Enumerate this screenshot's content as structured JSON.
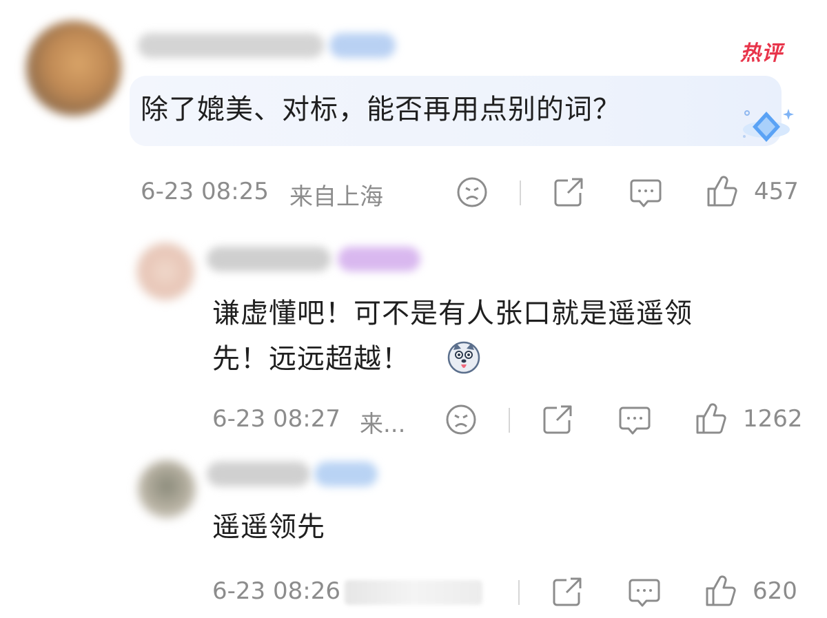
{
  "comments": [
    {
      "text": "除了媲美、对标，能否再用点别的词？",
      "time": "6-23 08:25",
      "location": "来自上海",
      "likes": "457",
      "badge": "热评"
    },
    {
      "text_line1": "谦虚懂吧！可不是有人张口就是遥遥领",
      "text_line2": "先！远远超越！",
      "time": "6-23 08:27",
      "location": "来...",
      "likes": "1262"
    },
    {
      "text": "遥遥领先",
      "time": "6-23 08:26",
      "likes": "620"
    }
  ],
  "colors": {
    "hot_badge": "#e8344a",
    "meta_text": "#8c8c8c",
    "bubble_bg": "#eef3fc",
    "diamond_badge": "#5aa2f5"
  },
  "icons": [
    "dislike-icon",
    "share-icon",
    "reply-icon",
    "like-icon",
    "diamond-badge-icon",
    "husky-emoji-icon"
  ]
}
